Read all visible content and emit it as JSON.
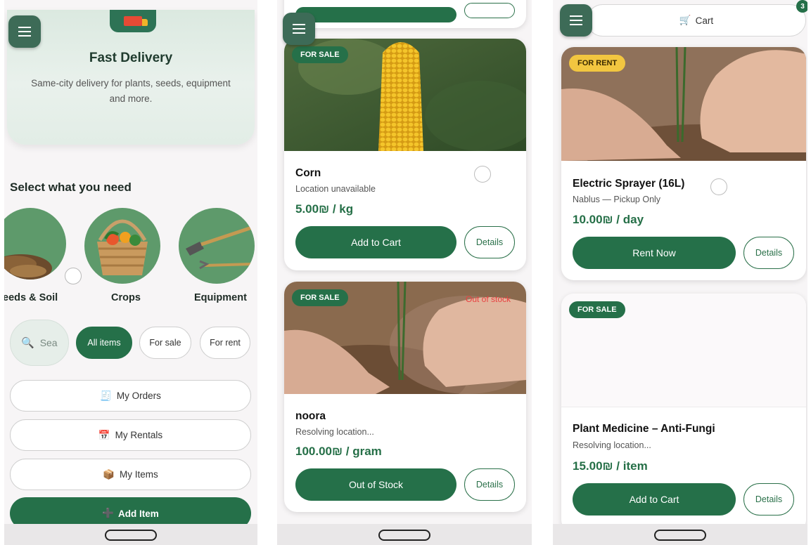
{
  "screen1": {
    "hero": {
      "title": "Fast Delivery",
      "subtitle": "Same-city delivery for plants, seeds, equipment and more."
    },
    "section_title": "Select what you need",
    "categories": [
      {
        "label": "eeds & Soil"
      },
      {
        "label": "Crops"
      },
      {
        "label": "Equipment"
      }
    ],
    "search": {
      "placeholder": "Sea"
    },
    "filters": [
      {
        "label": "All items",
        "active": true
      },
      {
        "label": "For sale",
        "active": false
      },
      {
        "label": "For rent",
        "active": false
      }
    ],
    "buttons": [
      {
        "icon": "receipt-icon",
        "label": "My Orders"
      },
      {
        "icon": "calendar-icon",
        "label": "My Rentals"
      },
      {
        "icon": "box-icon",
        "label": "My Items"
      }
    ],
    "add_item": {
      "icon": "plus-icon",
      "label": "Add Item"
    }
  },
  "screen2": {
    "products": [
      {
        "badge": "FOR SALE",
        "name": "Corn",
        "location": "Location unavailable",
        "price": "5.00₪ / kg",
        "action": "Add to Cart",
        "details": "Details"
      },
      {
        "badge": "FOR SALE",
        "status": "Out of stock",
        "name": "noora",
        "location": "Resolving location...",
        "price": "100.00₪ / gram",
        "action": "Out of Stock",
        "details": "Details"
      }
    ]
  },
  "screen3": {
    "cart": {
      "label": "Cart",
      "icon": "cart-icon",
      "count": "3"
    },
    "products": [
      {
        "badge": "FOR RENT",
        "name": "Electric Sprayer (16L)",
        "location": "Nablus — Pickup Only",
        "price": "10.00₪ / day",
        "action": "Rent Now",
        "details": "Details"
      },
      {
        "badge": "FOR SALE",
        "name": "Plant Medicine – Anti-Fungi",
        "location": "Resolving location...",
        "price": "15.00₪ / item",
        "action": "Add to Cart",
        "details": "Details"
      }
    ]
  },
  "colors": {
    "primary": "#257049",
    "menu": "#3d6b57",
    "rent_badge": "#f2c640",
    "price": "#256f47"
  }
}
